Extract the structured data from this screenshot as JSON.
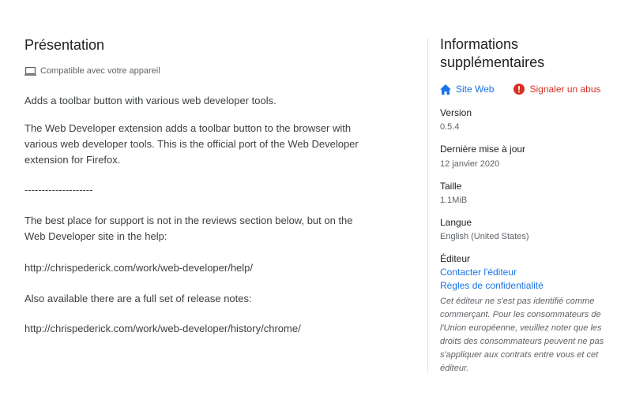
{
  "overview": {
    "title": "Présentation",
    "compatibility": "Compatible avec votre appareil",
    "short_description": "Adds a toolbar button with various web developer tools.",
    "long_description": "The Web Developer extension adds a toolbar button to the browser with various web developer tools. This is the official port of the Web Developer extension for Firefox.",
    "separator": "--------------------",
    "support_text": "The best place for support is not in the reviews section below, but on the Web Developer site in the help:",
    "help_url": "http://chrispederick.com/work/web-developer/help/",
    "release_notes_text": "Also available there are a full set of release notes:",
    "history_url": "http://chrispederick.com/work/web-developer/history/chrome/"
  },
  "info": {
    "title": "Informations supplémentaires",
    "website_label": "Site Web",
    "report_abuse_label": "Signaler un abus",
    "version_label": "Version",
    "version_value": "0.5.4",
    "updated_label": "Dernière mise à jour",
    "updated_value": "12 janvier 2020",
    "size_label": "Taille",
    "size_value": "1.1MiB",
    "language_label": "Langue",
    "language_value": "English (United States)",
    "publisher_label": "Éditeur",
    "contact_publisher": "Contacter l'éditeur",
    "privacy_policy": "Règles de confidentialité",
    "trader_note": "Cet éditeur ne s'est pas identifié comme commerçant. Pour les consommateurs de l'Union européenne, veuillez noter que les droits des consommateurs peuvent ne pas s'appliquer aux contrats entre vous et cet éditeur."
  },
  "icons": {
    "compat": "laptop-icon",
    "website": "home-icon",
    "abuse": "alert-icon"
  },
  "colors": {
    "link": "#1a73e8",
    "abuse": "#d93025"
  }
}
